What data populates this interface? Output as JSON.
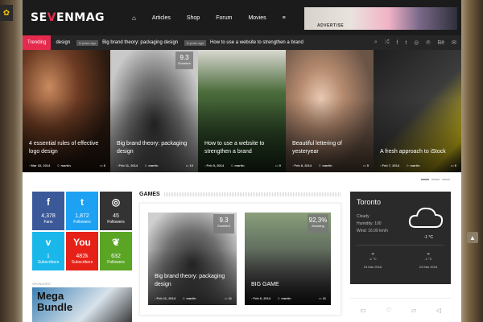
{
  "header": {
    "logo": {
      "part1": "SE",
      "accent": "V",
      "part2": "ENMAG"
    },
    "nav": [
      "Articles",
      "Shop",
      "Forum",
      "Movies"
    ],
    "home_icon": "home-icon",
    "menu_icon": "hamburger-icon",
    "ad_label": "ADVERTISE"
  },
  "trending": {
    "label": "Trending",
    "item1": "design",
    "ago1": "8 years ago",
    "item2": "Big brand theory: packaging design",
    "ago2": "8 years ago",
    "item3": "How to use a website to strengthen a brand"
  },
  "slider": [
    {
      "title": "4 essential rules of effective logo design",
      "date": "Mar 10, 2014",
      "author": "martin",
      "comments": "6",
      "score": "",
      "score_label": ""
    },
    {
      "title": "Big brand theory: packaging design",
      "date": "Feb 11, 2014",
      "author": "martin",
      "comments": "10",
      "score": "9.3",
      "score_label": "Excelent"
    },
    {
      "title": "How to use a website to strengthen a brand",
      "date": "Feb 9, 2014",
      "author": "martin",
      "comments": "0",
      "score": "",
      "score_label": ""
    },
    {
      "title": "Beautiful lettering of yesteryear",
      "date": "Feb 8, 2014",
      "author": "martin",
      "comments": "5",
      "score": "",
      "score_label": ""
    },
    {
      "title": "A fresh approach to iStock",
      "date": "Feb 7, 2014",
      "author": "martin",
      "comments": "6",
      "score": "",
      "score_label": ""
    }
  ],
  "social": [
    {
      "icon": "f",
      "count": "4,378",
      "label": "Fans"
    },
    {
      "icon": "t",
      "count": "1,872",
      "label": "Followers"
    },
    {
      "icon": "◎",
      "count": "45",
      "label": "Followers"
    },
    {
      "icon": "v",
      "count": "1",
      "label": "Subscribers"
    },
    {
      "icon": "You",
      "count": "482k",
      "label": "Subscribers"
    },
    {
      "icon": "❦",
      "count": "632",
      "label": "Followers"
    }
  ],
  "sponsors": {
    "label": "SPONSORS",
    "line1": "Mega",
    "line2": "Bundle"
  },
  "games": {
    "heading": "GAMES",
    "items": [
      {
        "title": "Big brand theory: packaging design",
        "date": "Feb 11, 2014",
        "author": "martin",
        "comments": "11",
        "score": "9.3",
        "score_label": "Excelent"
      },
      {
        "title": "BIG GAME",
        "date": "Feb 6, 2014",
        "author": "martin",
        "comments": "11",
        "score": "92,3%",
        "score_label": "Amazing"
      }
    ]
  },
  "weather": {
    "city": "Toronto",
    "condition": "Cloudy",
    "humidity": "Humidity: 100",
    "wind": "Wind: 16.09 km/h",
    "temp": "-1 °C",
    "forecast": [
      {
        "temp": "-1 °C",
        "date": "24 Mar 2016"
      },
      {
        "temp": "-1 °C",
        "date": "24 Mar 2016"
      }
    ]
  }
}
